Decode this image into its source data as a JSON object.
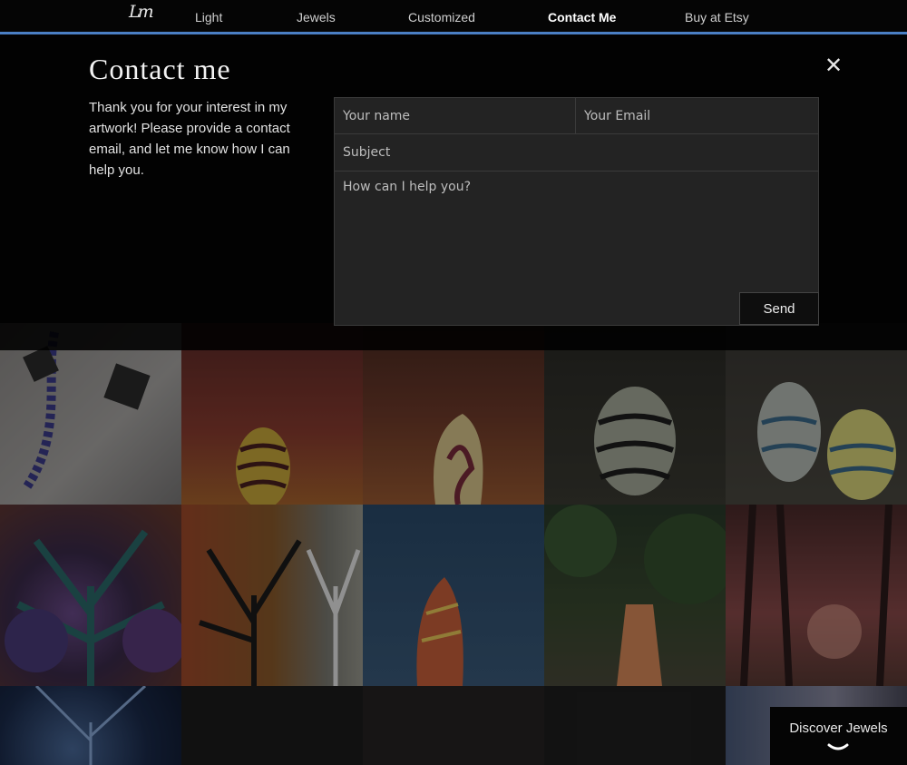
{
  "nav": {
    "logo": "Lm",
    "items": [
      {
        "label": "Light"
      },
      {
        "label": "Jewels"
      },
      {
        "label": "Customized"
      },
      {
        "label": "Contact Me",
        "active": true
      },
      {
        "label": "Buy at Etsy"
      }
    ],
    "accent_color": "#4a7fc4"
  },
  "contact": {
    "title": "Contact me",
    "intro": "Thank you for your interest in my artwork! Please provide a contact email, and let me know how I can help you.",
    "name_placeholder": "Your name",
    "email_placeholder": "Your Email",
    "subject_placeholder": "Subject",
    "message_placeholder": "How can I help you?",
    "send_label": "Send",
    "close_label": "✕"
  },
  "discover": {
    "label": "Discover Jewels"
  }
}
